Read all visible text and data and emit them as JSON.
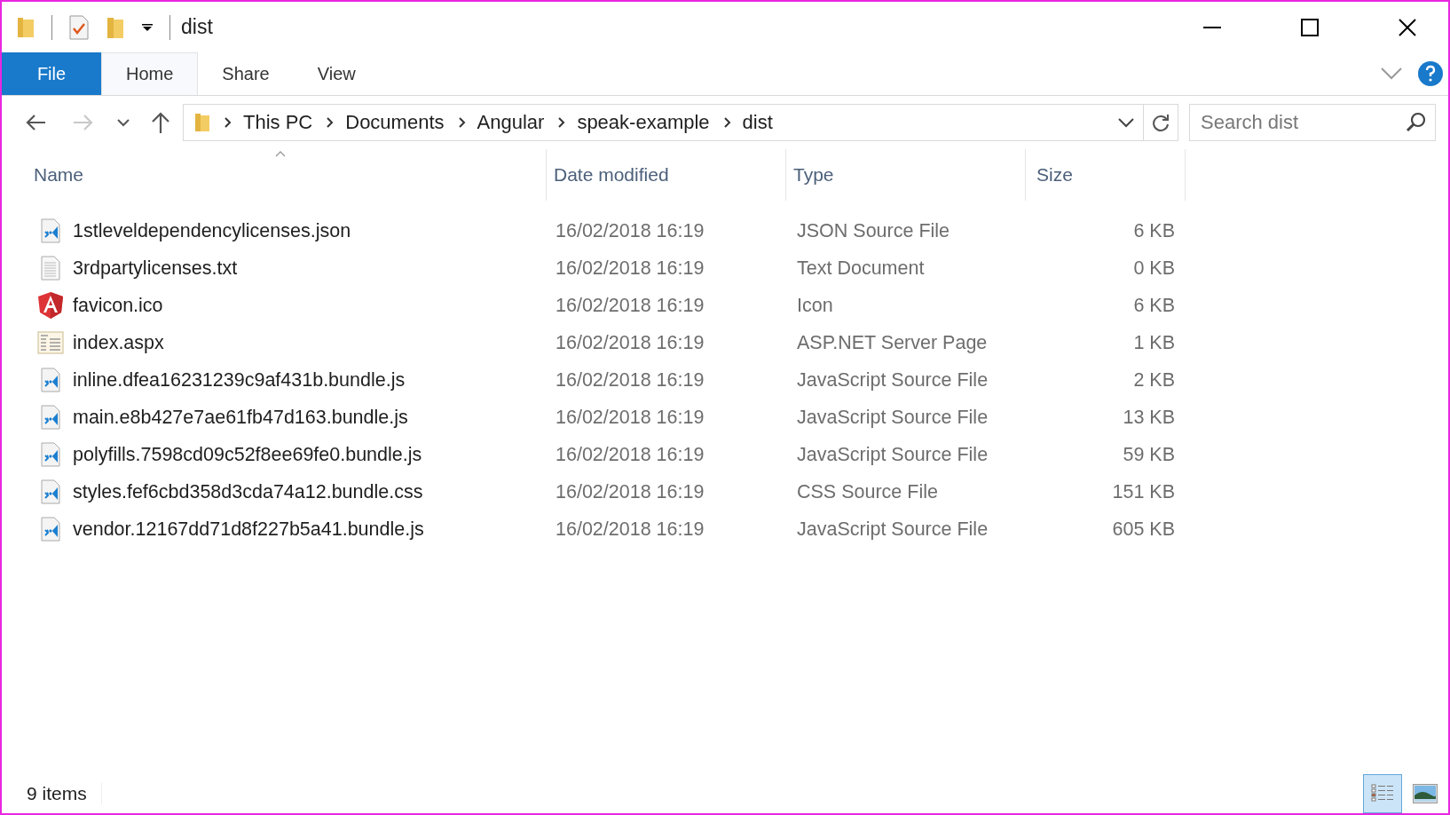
{
  "window": {
    "title": "dist"
  },
  "ribbon": {
    "file_button": "File",
    "tabs": [
      {
        "label": "Home",
        "selected": true
      },
      {
        "label": "Share",
        "selected": false
      },
      {
        "label": "View",
        "selected": false
      }
    ]
  },
  "address_bar": {
    "path": [
      "This PC",
      "Documents",
      "Angular",
      "speak-example",
      "dist"
    ]
  },
  "search": {
    "placeholder": "Search dist"
  },
  "table": {
    "columns": [
      "Name",
      "Date modified",
      "Type",
      "Size"
    ],
    "rows": [
      {
        "kind": "code",
        "name": "1stleveldependencylicenses.json",
        "date": "16/02/2018 16:19",
        "type": "JSON Source File",
        "size": "6 KB"
      },
      {
        "kind": "text",
        "name": "3rdpartylicenses.txt",
        "date": "16/02/2018 16:19",
        "type": "Text Document",
        "size": "0 KB"
      },
      {
        "kind": "angular",
        "name": "favicon.ico",
        "date": "16/02/2018 16:19",
        "type": "Icon",
        "size": "6 KB"
      },
      {
        "kind": "page",
        "name": "index.aspx",
        "date": "16/02/2018 16:19",
        "type": "ASP.NET Server Page",
        "size": "1 KB"
      },
      {
        "kind": "code",
        "name": "inline.dfea16231239c9af431b.bundle.js",
        "date": "16/02/2018 16:19",
        "type": "JavaScript Source File",
        "size": "2 KB"
      },
      {
        "kind": "code",
        "name": "main.e8b427e7ae61fb47d163.bundle.js",
        "date": "16/02/2018 16:19",
        "type": "JavaScript Source File",
        "size": "13 KB"
      },
      {
        "kind": "code",
        "name": "polyfills.7598cd09c52f8ee69fe0.bundle.js",
        "date": "16/02/2018 16:19",
        "type": "JavaScript Source File",
        "size": "59 KB"
      },
      {
        "kind": "code",
        "name": "styles.fef6cbd358d3cda74a12.bundle.css",
        "date": "16/02/2018 16:19",
        "type": "CSS Source File",
        "size": "151 KB"
      },
      {
        "kind": "code",
        "name": "vendor.12167dd71d8f227b5a41.bundle.js",
        "date": "16/02/2018 16:19",
        "type": "JavaScript Source File",
        "size": "605 KB"
      }
    ]
  },
  "status_bar": {
    "count": "9 items",
    "views": [
      {
        "kind": "details",
        "selected": true
      },
      {
        "kind": "large_icons",
        "selected": false
      }
    ]
  }
}
